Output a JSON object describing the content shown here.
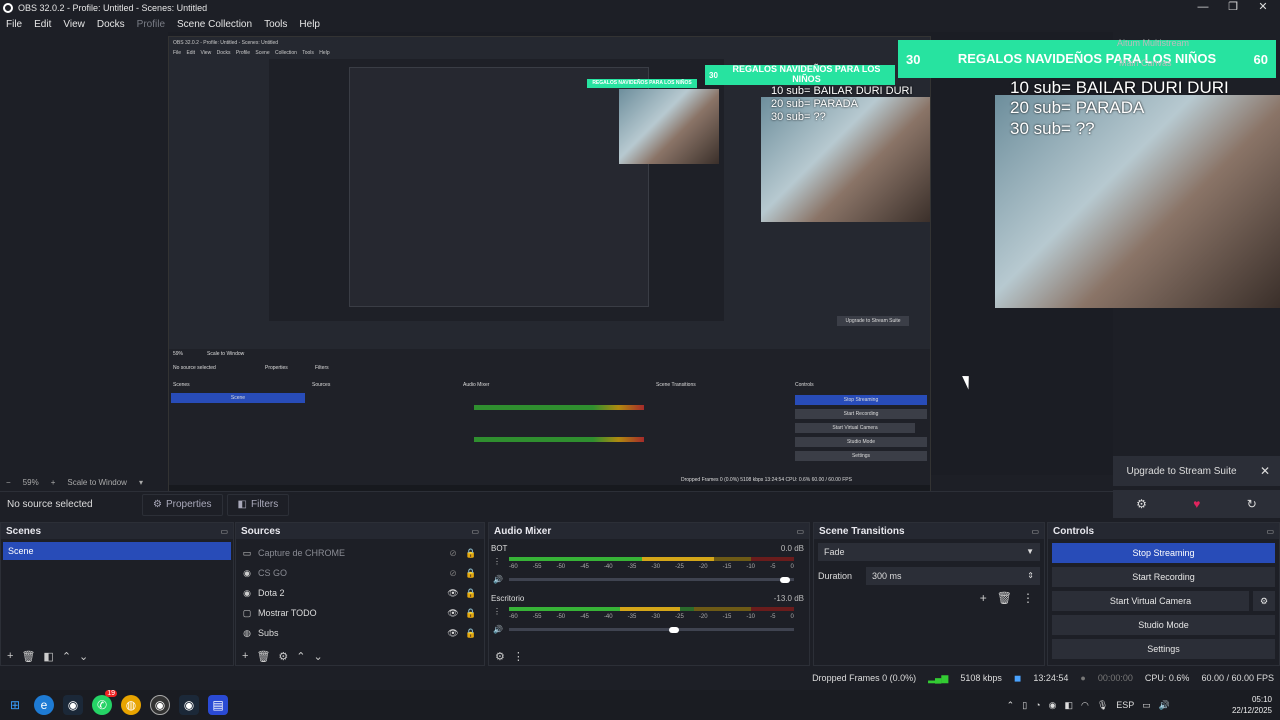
{
  "window": {
    "title": "OBS 32.0.2 - Profile: Untitled - Scenes: Untitled",
    "min": "—",
    "max": "❐",
    "close": "✕"
  },
  "menu": [
    "File",
    "Edit",
    "View",
    "Docks",
    "Profile",
    "Scene Collection",
    "Tools",
    "Help"
  ],
  "preview": {
    "inner_title": "OBS 32.0.2 - Profile: Untitled - Scenes: Untitled",
    "inner_menu": "File Edit View Docks Profile Scene Collection Tools Help",
    "banner_big": {
      "left": "30",
      "text": "REGALOS NAVIDEÑOS PARA LOS NIÑOS",
      "right": "60"
    },
    "banner_small": {
      "left": "30",
      "text": "REGALOS NAVIDEÑOS PARA LOS NIÑOS"
    },
    "overlay_lines": [
      "10 sub= BAILAR DURI DURI",
      "20 sub= PARADA",
      "30 sub= ??"
    ],
    "ghost_labels": [
      "Aitum Multistream",
      "Main Canvas"
    ],
    "inner_zoom": "59%",
    "inner_scale": "Scale to Window",
    "inner_nosrc": "No source selected",
    "inner_props": "Properties",
    "inner_filters": "Filters",
    "inner_docks": [
      "Scenes",
      "Sources",
      "Audio Mixer",
      "Scene Transitions",
      "Controls"
    ],
    "inner_buttons": [
      "Stop Streaming",
      "Start Recording",
      "Start Virtual Camera",
      "Studio Mode",
      "Settings"
    ],
    "inner_upgrade": "Upgrade to Stream Suite",
    "inner_status": "Dropped Frames 0 (0.0%)   5108 kbps   13:24:54   CPU: 0.6%   60.00 / 60.00 FPS"
  },
  "zoom": {
    "value": "59%",
    "mode": "Scale to Window"
  },
  "source_bar": {
    "no_source": "No source selected",
    "properties": "Properties",
    "filters": "Filters"
  },
  "right_panel": {
    "upgrade": "Upgrade to Stream Suite",
    "close": "✕"
  },
  "docks": {
    "scenes": {
      "title": "Scenes",
      "items": [
        "Scene"
      ]
    },
    "sources": {
      "title": "Sources",
      "items": [
        {
          "name": "Capture de CHROME",
          "icon": "window-capture-icon",
          "dim": true
        },
        {
          "name": "CS GO",
          "icon": "game-capture-icon",
          "dim": true
        },
        {
          "name": "Dota 2",
          "icon": "game-capture-icon",
          "dim": false
        },
        {
          "name": "Mostrar TODO",
          "icon": "display-capture-icon",
          "dim": false
        },
        {
          "name": "Subs",
          "icon": "browser-source-icon",
          "dim": false
        }
      ]
    },
    "mixer": {
      "title": "Audio Mixer",
      "channels": [
        {
          "name": "BOT",
          "db": "0.0 dB",
          "level": 0.72,
          "volume": 0.97
        },
        {
          "name": "Escritorio",
          "db": "-13.0 dB",
          "level": 0.6,
          "volume": 0.58
        }
      ],
      "ticks": [
        "-60",
        "-55",
        "-50",
        "-45",
        "-40",
        "-35",
        "-30",
        "-25",
        "-20",
        "-15",
        "-10",
        "-5",
        "0"
      ]
    },
    "transitions": {
      "title": "Scene Transitions",
      "selected": "Fade",
      "duration_label": "Duration",
      "duration": "300 ms"
    },
    "controls": {
      "title": "Controls",
      "buttons": [
        "Stop Streaming",
        "Start Recording",
        "Start Virtual Camera",
        "Studio Mode",
        "Settings"
      ]
    }
  },
  "status": {
    "dropped": "Dropped Frames 0 (0.0%)",
    "bitrate": "5108 kbps",
    "stream_time": "13:24:54",
    "rec_time": "00:00:00",
    "cpu": "CPU: 0.6%",
    "fps": "60.00 / 60.00 FPS"
  },
  "taskbar": {
    "lang": "ESP",
    "time": "05:10",
    "date": "22/12/2025",
    "whatsapp_badge": "19"
  },
  "colors": {
    "accent": "#284cb8",
    "banner": "#27e3a0",
    "bg": "#1d1f26"
  }
}
